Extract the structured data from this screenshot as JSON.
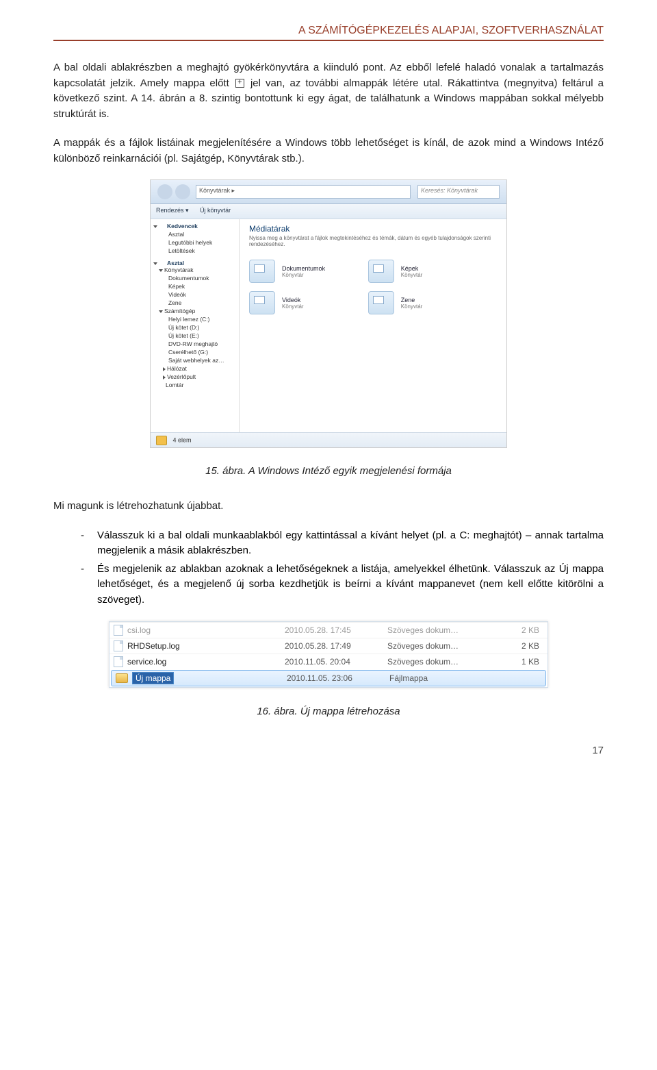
{
  "header": "A SZÁMÍTÓGÉPKEZELÉS ALAPJAI, SZOFTVERHASZNÁLAT",
  "paragraphs": {
    "p1a": "A bal oldali ablakrészben a meghajtó gyökérkönyvtára a kiinduló pont. Az ebből lefelé haladó vonalak a tartalmazás kapcsolatát jelzik. Amely mappa előtt ",
    "p1b": " jel van, az további almappák létére utal. Rákattintva (megnyitva) feltárul a következő szint. A 14. ábrán a 8. szintig bontottunk ki egy ágat, de találhatunk a Windows mappában sokkal mélyebb struktúrát is.",
    "p2": "A mappák és a fájlok listáinak megjelenítésére a Windows több lehetőséget is kínál, de azok mind a Windows Intéző különböző reinkarnációi (pl. Sajátgép, Könyvtárak stb.).",
    "cap15": "15. ábra. A Windows Intéző egyik megjelenési formája",
    "p3": "Mi magunk is létrehozhatunk újabbat.",
    "li1": "Válasszuk ki a bal oldali munkaablakból egy kattintással a kívánt helyet (pl. a C: meghajtót) – annak tartalma megjelenik a másik ablakrészben.",
    "li2": "És megjelenik az ablakban azoknak a lehetőségeknek a listája, amelyekkel élhetünk. Válasszuk az Új mappa lehetőséget, és a megjelenő új sorba kezdhetjük is beírni a kívánt mappanevet (nem kell előtte kitörölni a szöveget).",
    "cap16": "16. ábra. Új mappa létrehozása"
  },
  "fig15": {
    "breadcrumb": "Könyvtárak ▸",
    "search_placeholder": "Keresés: Könyvtárak",
    "toolbar": {
      "a": "Rendezés ▾",
      "b": "Új könyvtár"
    },
    "sidebar": {
      "g1": "Kedvencek",
      "g1a": "Asztal",
      "g1b": "Legutóbbi helyek",
      "g1c": "Letöltések",
      "g2": "Asztal",
      "g2a": "Könyvtárak",
      "g2b": "Dokumentumok",
      "g2c": "Képek",
      "g2d": "Videók",
      "g2e": "Zene",
      "g3": "Számítógép",
      "g3a": "Helyi lemez (C:)",
      "g3b": "Új kötet (D:)",
      "g3c": "Új kötet (E:)",
      "g3d": "DVD-RW meghajtó",
      "g3e": "Cserélhető (G:)",
      "g3f": "Saját webhelyek az…",
      "g4": "Hálózat",
      "g5": "Vezérlőpult",
      "g6": "Lomtár"
    },
    "main": {
      "title": "Médiatárak",
      "subtitle": "Nyissa meg a könyvtárat a fájlok megtekintéséhez és témák, dátum és egyéb tulajdonságok szerinti rendezéséhez.",
      "libs": [
        {
          "name": "Dokumentumok",
          "sub": "Könyvtár"
        },
        {
          "name": "Képek",
          "sub": "Könyvtár"
        },
        {
          "name": "Videók",
          "sub": "Könyvtár"
        },
        {
          "name": "Zene",
          "sub": "Könyvtár"
        }
      ]
    },
    "status": "4 elem"
  },
  "fig16": {
    "rows": [
      {
        "name": "csi.log",
        "date": "2010.05.28. 17:45",
        "type": "Szöveges dokum…",
        "size": "2 KB",
        "cls": "dimmed"
      },
      {
        "name": "RHDSetup.log",
        "date": "2010.05.28. 17:49",
        "type": "Szöveges dokum…",
        "size": "2 KB"
      },
      {
        "name": "service.log",
        "date": "2010.11.05. 20:04",
        "type": "Szöveges dokum…",
        "size": "1 KB"
      },
      {
        "name": "Új mappa",
        "date": "2010.11.05. 23:06",
        "type": "Fájlmappa",
        "size": "",
        "sel": true
      }
    ]
  },
  "pagenum": "17"
}
